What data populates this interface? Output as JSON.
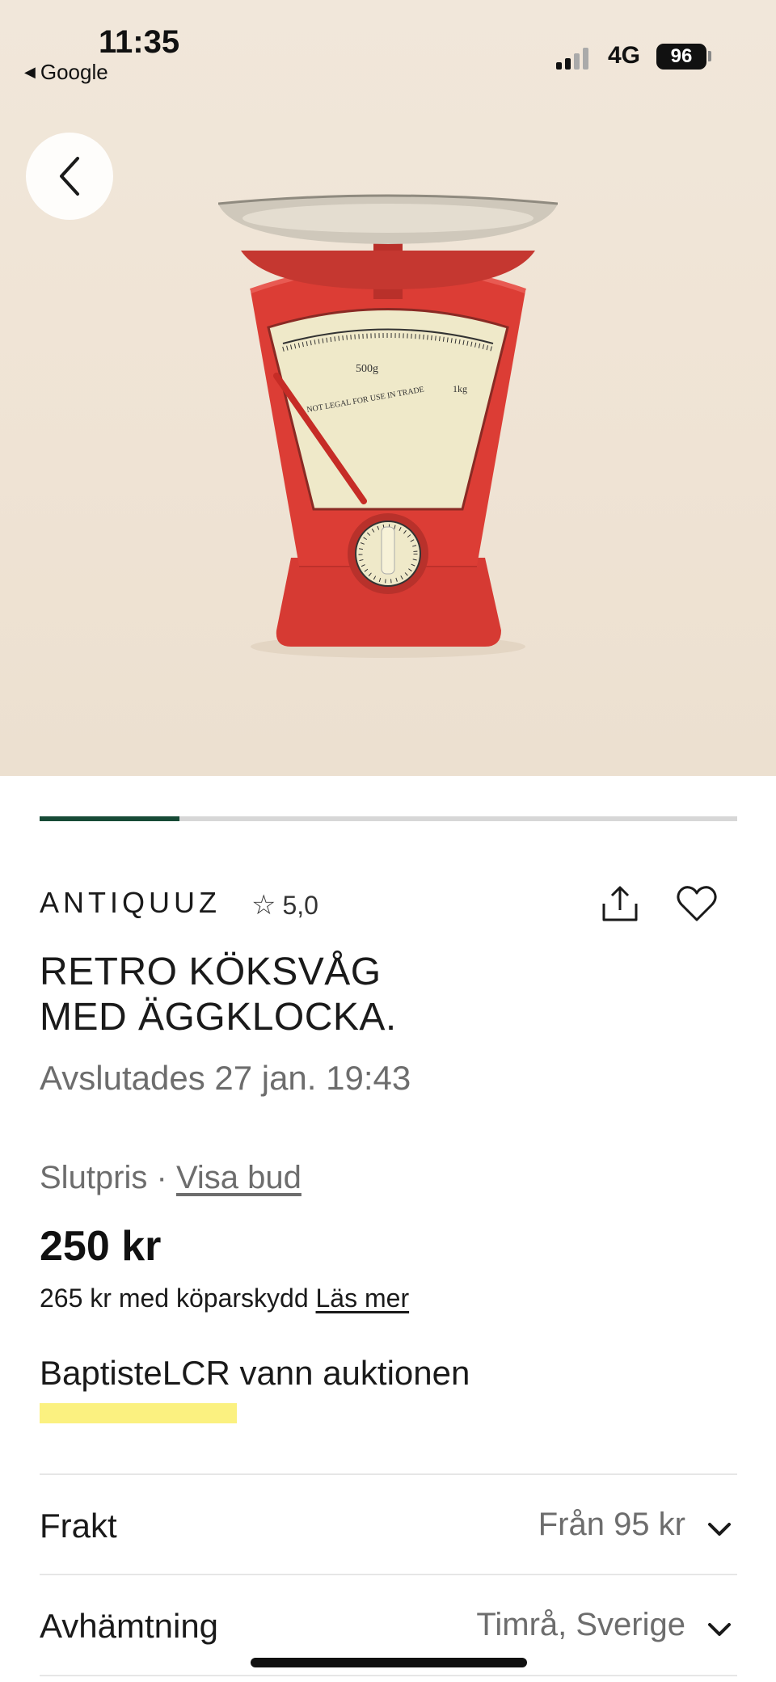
{
  "status_bar": {
    "time": "11:35",
    "back_app": "Google",
    "network": "4G",
    "battery": "96"
  },
  "hero": {
    "image_icon": "kitchen-scale-photo",
    "back_icon": "chevron-left-icon",
    "gallery_progress": 0.2
  },
  "seller": {
    "name": "ANTIQUUZ",
    "rating": "5,0",
    "star_icon": "star-outline-icon"
  },
  "actions": {
    "share_icon": "share-icon",
    "favorite_icon": "heart-outline-icon"
  },
  "listing": {
    "title_line1": "RETRO KÖKSVÅG",
    "title_line2": "MED ÄGGKLOCKA.",
    "ended": "Avslutades 27 jan. 19:43"
  },
  "price": {
    "label": "Slutpris",
    "separator": " · ",
    "bids_link": "Visa bud",
    "amount": "250 kr",
    "protection": "265 kr med köparskydd",
    "read_more": "Läs mer"
  },
  "winner": {
    "text": "BaptisteLCR vann auktionen",
    "highlight_color": "#fbf180"
  },
  "rows": [
    {
      "label": "Frakt",
      "value": "Från 95 kr",
      "icon": "chevron-down-icon"
    },
    {
      "label": "Avhämtning",
      "value": "Timrå, Sverige",
      "icon": "chevron-down-icon"
    }
  ],
  "colors": {
    "accent": "#174a36",
    "muted_text": "#6d6d6d",
    "scale_red": "#d93a34"
  }
}
